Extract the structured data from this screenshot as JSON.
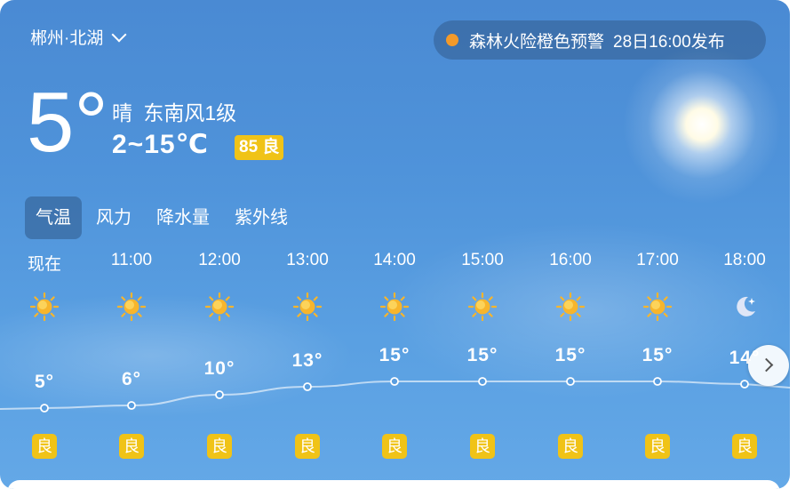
{
  "location": "郴州·北湖",
  "alert": {
    "text": "森林火险橙色预警",
    "time": "28日16:00发布",
    "color": "#f39a2a"
  },
  "current": {
    "temp": "5°",
    "condition": "晴",
    "wind": "东南风1级",
    "range": "2~15℃",
    "aqi": "85 良"
  },
  "tabs": [
    "气温",
    "风力",
    "降水量",
    "紫外线"
  ],
  "hours": [
    {
      "time": "现在",
      "icon": "sun-icon",
      "temp": 5,
      "label": "5°",
      "quality": "良"
    },
    {
      "time": "11:00",
      "icon": "sun-icon",
      "temp": 6,
      "label": "6°",
      "quality": "良"
    },
    {
      "time": "12:00",
      "icon": "sun-icon",
      "temp": 10,
      "label": "10°",
      "quality": "良"
    },
    {
      "time": "13:00",
      "icon": "sun-icon",
      "temp": 13,
      "label": "13°",
      "quality": "良"
    },
    {
      "time": "14:00",
      "icon": "sun-icon",
      "temp": 15,
      "label": "15°",
      "quality": "良"
    },
    {
      "time": "15:00",
      "icon": "sun-icon",
      "temp": 15,
      "label": "15°",
      "quality": "良"
    },
    {
      "time": "16:00",
      "icon": "sun-icon",
      "temp": 15,
      "label": "15°",
      "quality": "良"
    },
    {
      "time": "17:00",
      "icon": "sun-icon",
      "temp": 15,
      "label": "15°",
      "quality": "良"
    },
    {
      "time": "18:00",
      "icon": "moon-icon",
      "temp": 14,
      "label": "14°",
      "quality": "良"
    }
  ],
  "colors": {
    "quality_badge": "#f0c317"
  }
}
